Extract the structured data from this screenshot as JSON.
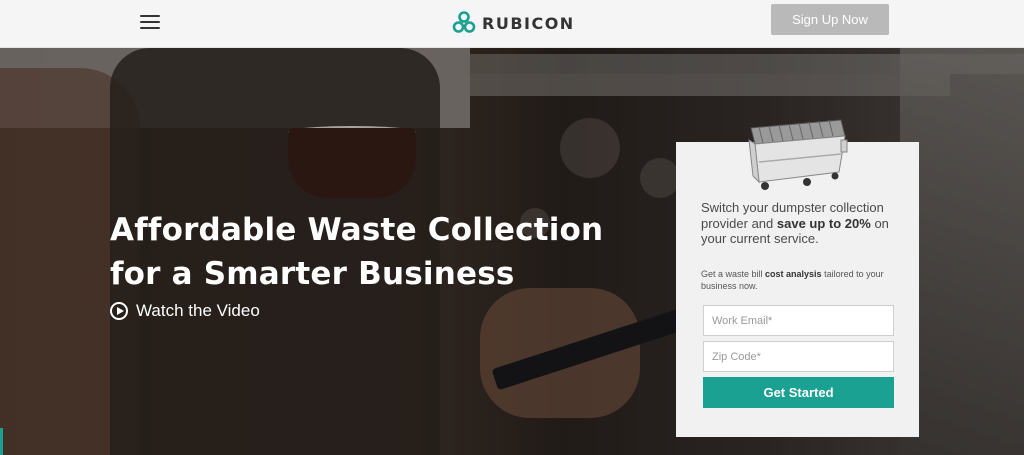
{
  "header": {
    "brand_name": "RUBICON",
    "signup_label": "Sign Up Now",
    "icons": {
      "menu": "hamburger-menu-icon",
      "logo": "rubicon-logo-icon"
    }
  },
  "hero": {
    "title_line1": "Affordable Waste Collection",
    "title_line2": "for a Smarter Business",
    "watch_video_label": "Watch the Video",
    "icons": {
      "play": "play-circle-icon"
    }
  },
  "form": {
    "headline_prefix": "Switch your dumpster collection provider and ",
    "headline_bold": "save up to 20%",
    "headline_suffix": " on your current service.",
    "sub_prefix": "Get a waste bill ",
    "sub_bold": "cost analysis",
    "sub_suffix": " tailored to your business now.",
    "email_placeholder": "Work Email*",
    "email_value": "",
    "zip_placeholder": "Zip Code*",
    "zip_value": "",
    "submit_label": "Get Started",
    "image": "dumpster-image"
  },
  "colors": {
    "accent": "#1aa191",
    "signup_button": "#b9b9b9",
    "header_bg": "#f5f5f5",
    "card_bg": "#f1f1f1"
  }
}
